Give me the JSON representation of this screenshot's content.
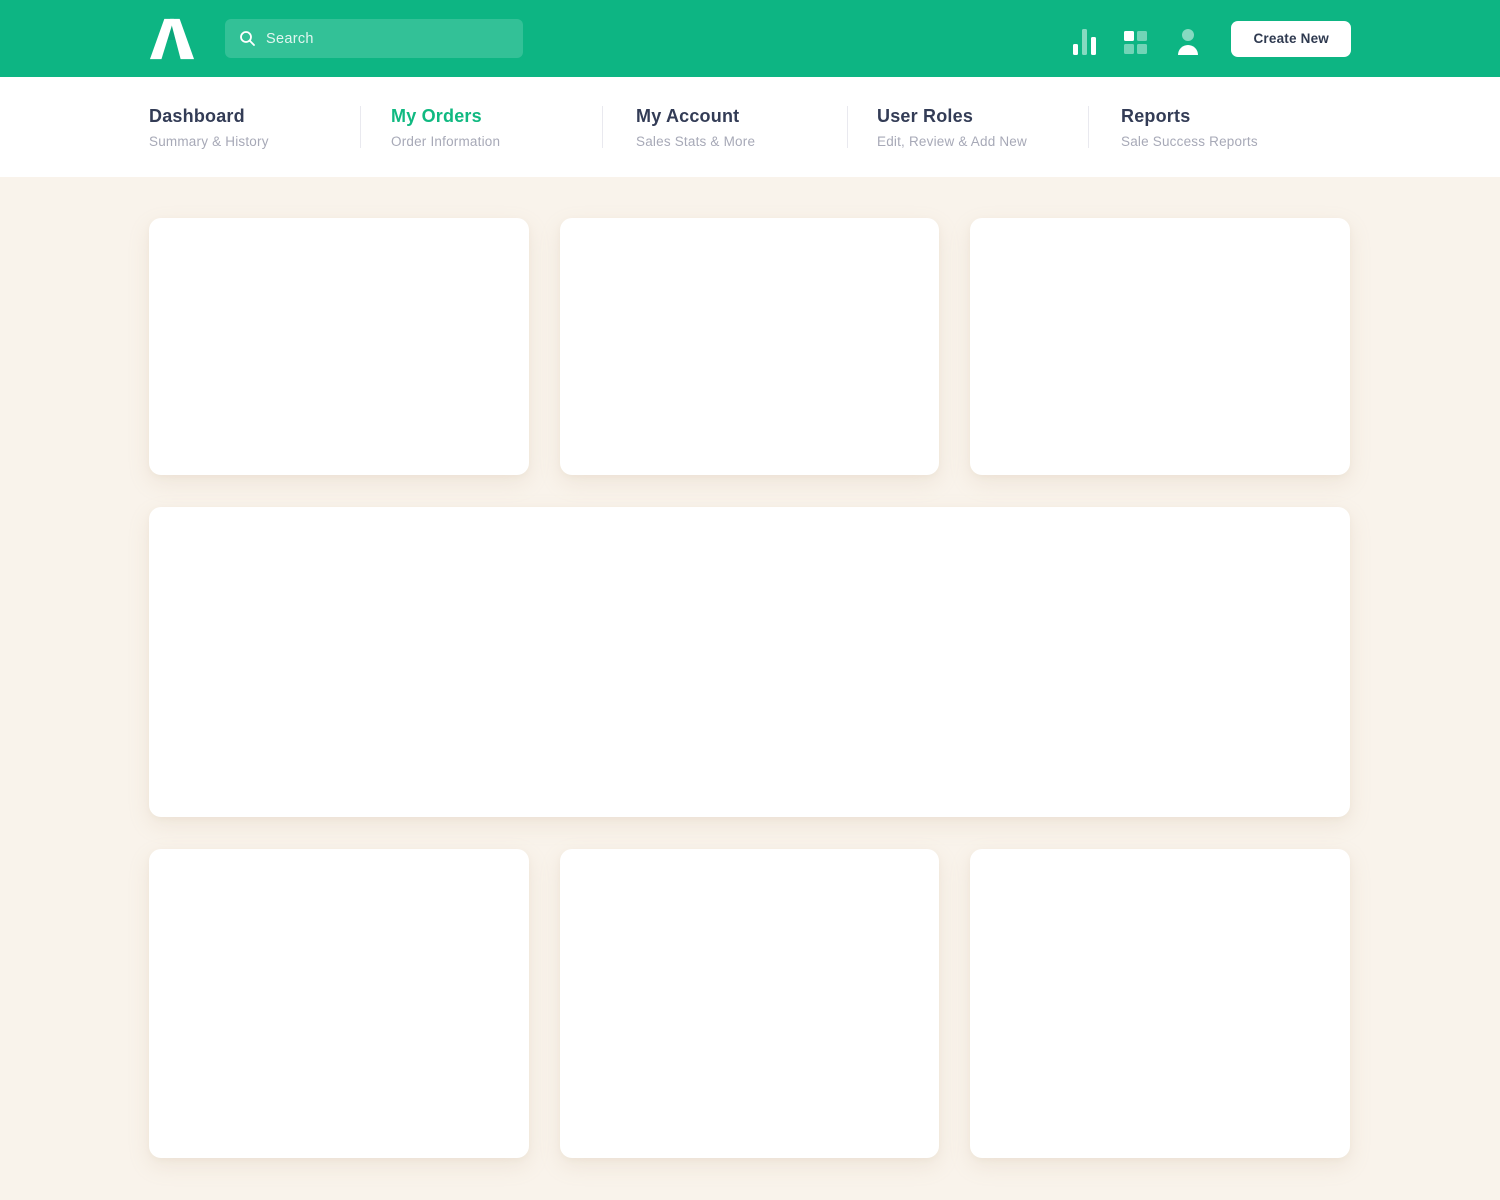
{
  "header": {
    "search_placeholder": "Search",
    "create_button_label": "Create New",
    "icons": [
      "bar-chart-icon",
      "grid-icon",
      "user-icon"
    ]
  },
  "nav": {
    "active_tab": "My Orders",
    "tabs": [
      {
        "label": "Dashboard",
        "sublabel": "Summary & History"
      },
      {
        "label": "My Orders",
        "sublabel": "Order Information"
      },
      {
        "label": "My Account",
        "sublabel": "Sales Stats & More"
      },
      {
        "label": "User Roles",
        "sublabel": "Edit, Review & Add New"
      },
      {
        "label": "Reports",
        "sublabel": "Sale Success Reports"
      }
    ]
  },
  "colors": {
    "header_bg": "#0db583",
    "active_tab_text": "#10b981",
    "heading_text": "#333c56",
    "subtitle_text": "#a7a9b7",
    "page_bg": "#f9f3eb",
    "card_bg": "#ffffff",
    "button_text": "#2f3a50"
  },
  "layout": {
    "empty_card_count": 7
  }
}
